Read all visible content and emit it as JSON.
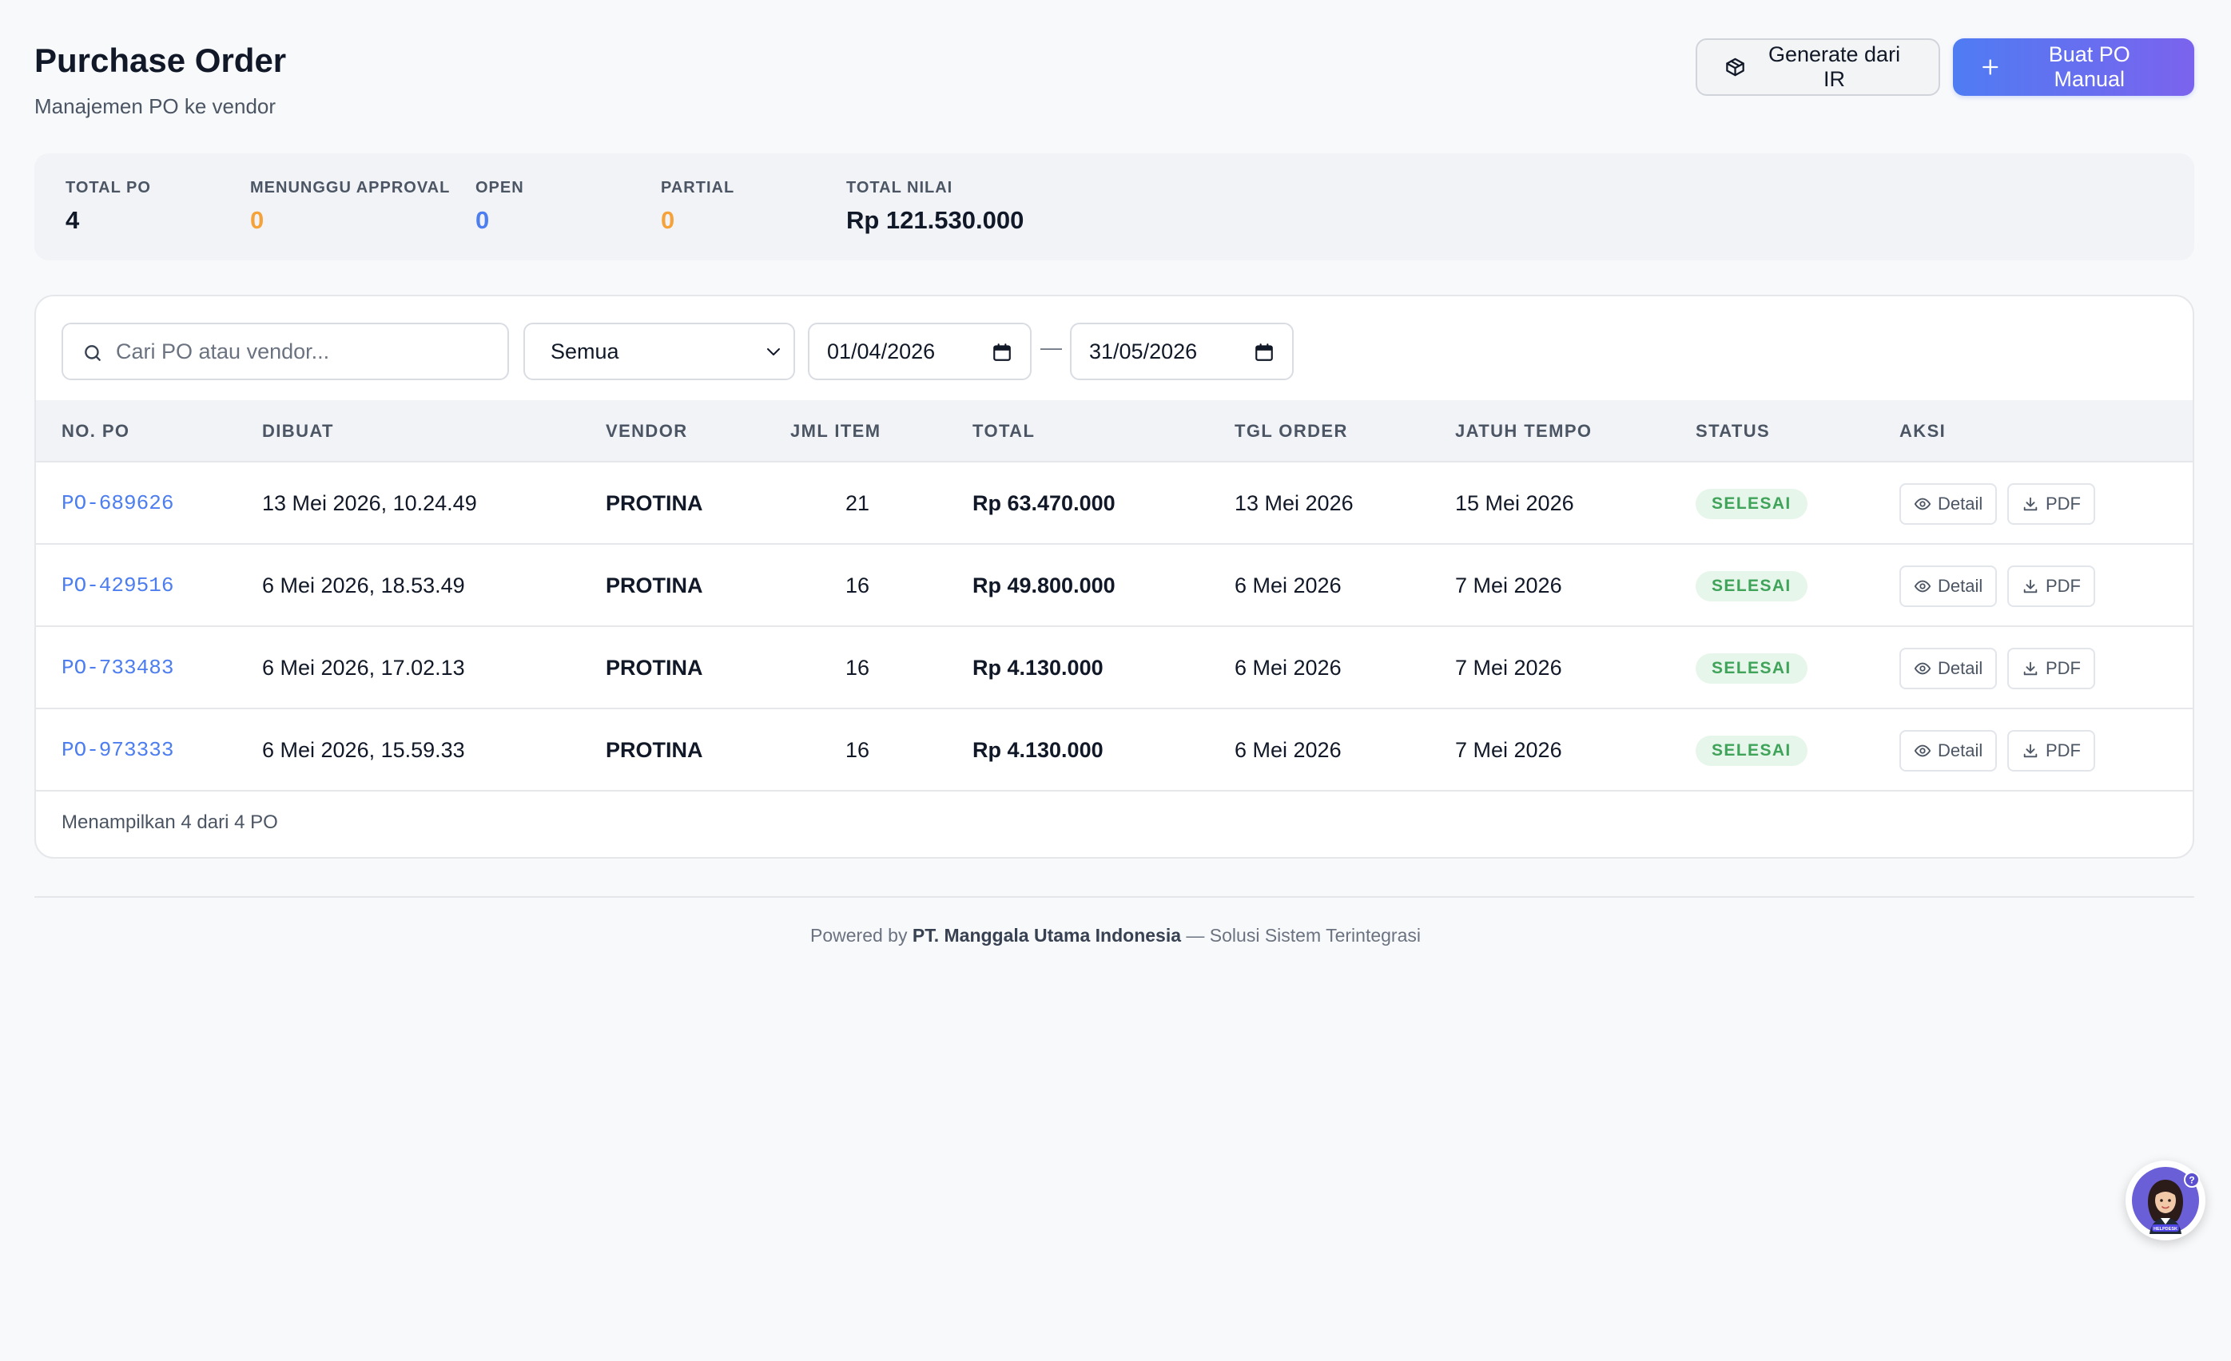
{
  "header": {
    "title": "Purchase Order",
    "subtitle": "Manajemen PO ke vendor"
  },
  "actions": {
    "generate_label": "Generate dari IR",
    "create_label": "Buat PO Manual"
  },
  "stats": [
    {
      "label": "TOTAL PO",
      "value": "4"
    },
    {
      "label": "MENUNGGU APPROVAL",
      "value": "0"
    },
    {
      "label": "OPEN",
      "value": "0"
    },
    {
      "label": "PARTIAL",
      "value": "0"
    },
    {
      "label": "TOTAL NILAI",
      "value": "Rp 121.530.000"
    }
  ],
  "filters": {
    "search_placeholder": "Cari PO atau vendor...",
    "status_selected": "Semua",
    "date_from": "01/04/2026",
    "date_separator": "—",
    "date_to": "31/05/2026"
  },
  "table": {
    "columns": [
      "NO. PO",
      "DIBUAT",
      "VENDOR",
      "JML ITEM",
      "TOTAL",
      "TGL ORDER",
      "JATUH TEMPO",
      "STATUS",
      "AKSI"
    ],
    "detail_label": "Detail",
    "pdf_label": "PDF",
    "rows": [
      {
        "po": "PO-689626",
        "created": "13 Mei 2026, 10.24.49",
        "vendor": "PROTINA",
        "items": "21",
        "total": "Rp 63.470.000",
        "order_date": "13 Mei 2026",
        "due_date": "15 Mei 2026",
        "status": "SELESAI"
      },
      {
        "po": "PO-429516",
        "created": "6 Mei 2026, 18.53.49",
        "vendor": "PROTINA",
        "items": "16",
        "total": "Rp 49.800.000",
        "order_date": "6 Mei 2026",
        "due_date": "7 Mei 2026",
        "status": "SELESAI"
      },
      {
        "po": "PO-733483",
        "created": "6 Mei 2026, 17.02.13",
        "vendor": "PROTINA",
        "items": "16",
        "total": "Rp 4.130.000",
        "order_date": "6 Mei 2026",
        "due_date": "7 Mei 2026",
        "status": "SELESAI"
      },
      {
        "po": "PO-973333",
        "created": "6 Mei 2026, 15.59.33",
        "vendor": "PROTINA",
        "items": "16",
        "total": "Rp 4.130.000",
        "order_date": "6 Mei 2026",
        "due_date": "7 Mei 2026",
        "status": "SELESAI"
      }
    ],
    "summary": "Menampilkan 4 dari 4 PO"
  },
  "footer": {
    "prefix": "Powered by",
    "company": "PT. Manggala Utama Indonesia",
    "suffix": "— Solusi Sistem Terintegrasi"
  },
  "helper": {
    "badge": "HELPDESK",
    "icon": "assistant-avatar-icon"
  },
  "colors": {
    "accent_blue": "#4d7ef0",
    "accent_purple": "#7b63ee",
    "warning_orange": "#f5a23a",
    "success_green": "#3fa35a"
  }
}
